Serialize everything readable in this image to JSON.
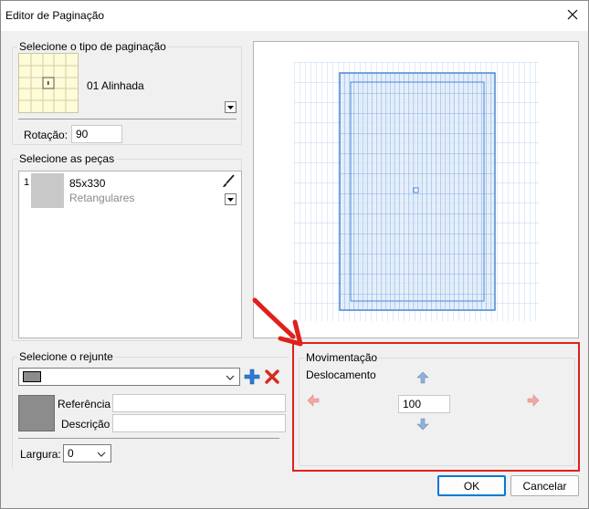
{
  "window": {
    "title": "Editor de Paginação"
  },
  "pagination_type": {
    "group_label": "Selecione o tipo de paginação",
    "selected_name": "01 Alinhada",
    "rotation_label": "Rotação:",
    "rotation_value": "90"
  },
  "pieces": {
    "group_label": "Selecione as peças",
    "items": [
      {
        "index": "1",
        "size": "85x330",
        "type": "Retangulares"
      }
    ]
  },
  "grout": {
    "group_label": "Selecione o rejunte",
    "reference_label": "Referência",
    "description_label": "Descrição",
    "reference_value": "",
    "description_value": "",
    "width_label": "Largura:",
    "width_value": "0"
  },
  "movement": {
    "group_label": "Movimentação",
    "displacement_label": "Deslocamento",
    "displacement_value": "100"
  },
  "footer": {
    "ok_label": "OK",
    "cancel_label": "Cancelar"
  },
  "colors": {
    "highlight_red": "#e0201b",
    "grout_swatch": "#8c8c8c",
    "preview_grid": "#a9c7ef",
    "preview_tile": "#4a86d6",
    "accent": "#0078d4"
  }
}
